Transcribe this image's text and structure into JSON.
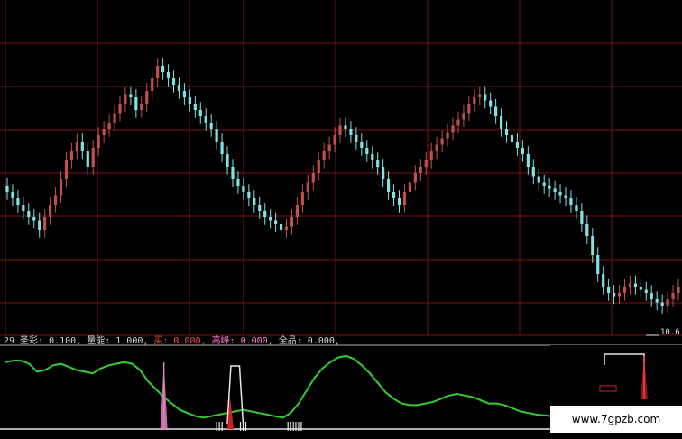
{
  "indicator": {
    "id": "29",
    "param1": "圣彩: 0.100,",
    "param2": "量能: 1.000,",
    "param3": "买: 0.000,",
    "param4": "高峰: 0.000,",
    "param5": "全品: 0.000,"
  },
  "price_label": "10.6",
  "watermark": "www.7gpzb.com",
  "colors": {
    "background": "#000000",
    "grid": "#7a1212",
    "up_candle": "#c0504d",
    "down_candle": "#7fe3e3",
    "osc_line": "#33cc33",
    "signal_pink": "#e080c0",
    "signal_white": "#e8e8e8",
    "signal_red": "#cc2222"
  },
  "chart_data": [
    {
      "type": "candlestick",
      "title": "",
      "xlabel": "",
      "ylabel": "",
      "y_domain": [
        0,
        100
      ],
      "grid": true,
      "closes": [
        42,
        40,
        38,
        36,
        34,
        33,
        30,
        34,
        38,
        41,
        46,
        52,
        55,
        58,
        55,
        50,
        56,
        60,
        62,
        64,
        67,
        70,
        73,
        72,
        68,
        70,
        74,
        78,
        82,
        80,
        78,
        76,
        74,
        72,
        70,
        68,
        66,
        64,
        62,
        58,
        54,
        50,
        46,
        44,
        42,
        40,
        38,
        36,
        34,
        33,
        32,
        30,
        31,
        34,
        38,
        42,
        45,
        48,
        52,
        55,
        57,
        60,
        63,
        62,
        60,
        58,
        56,
        54,
        52,
        50,
        46,
        42,
        40,
        38,
        42,
        45,
        48,
        50,
        52,
        55,
        57,
        59,
        61,
        63,
        65,
        67,
        70,
        72,
        73,
        71,
        69,
        66,
        62,
        60,
        58,
        56,
        54,
        50,
        47,
        45,
        44,
        43,
        42,
        41,
        40,
        38,
        36,
        32,
        28,
        22,
        16,
        12,
        10,
        9,
        10,
        12,
        13,
        12,
        11,
        10,
        8,
        7,
        6,
        8,
        10,
        12
      ],
      "note": "closing levels, relative scale (0 = lowest, 100 = highest on chart)"
    },
    {
      "type": "line",
      "title": "",
      "xlabel": "",
      "ylabel": "",
      "y_domain": [
        0,
        100
      ],
      "series": [
        {
          "values": [
            82,
            84,
            84,
            80,
            70,
            72,
            78,
            80,
            76,
            72,
            70,
            68,
            74,
            78,
            80,
            82,
            80,
            72,
            58,
            48,
            38,
            30,
            22,
            18,
            14,
            12,
            14,
            16,
            18,
            20,
            22,
            20,
            18,
            16,
            14,
            12,
            18,
            30,
            46,
            62,
            74,
            82,
            88,
            90,
            86,
            78,
            68,
            56,
            44,
            36,
            30,
            28,
            28,
            30,
            32,
            36,
            40,
            42,
            40,
            38,
            34,
            30,
            30,
            28,
            24,
            20,
            18,
            16,
            15,
            14
          ]
        }
      ],
      "signals": {
        "pink_spike_at": 20,
        "white_box_range": [
          28,
          30
        ],
        "ticks_at": [
          27,
          30,
          36,
          37
        ],
        "red_spike_at": 68
      }
    }
  ]
}
